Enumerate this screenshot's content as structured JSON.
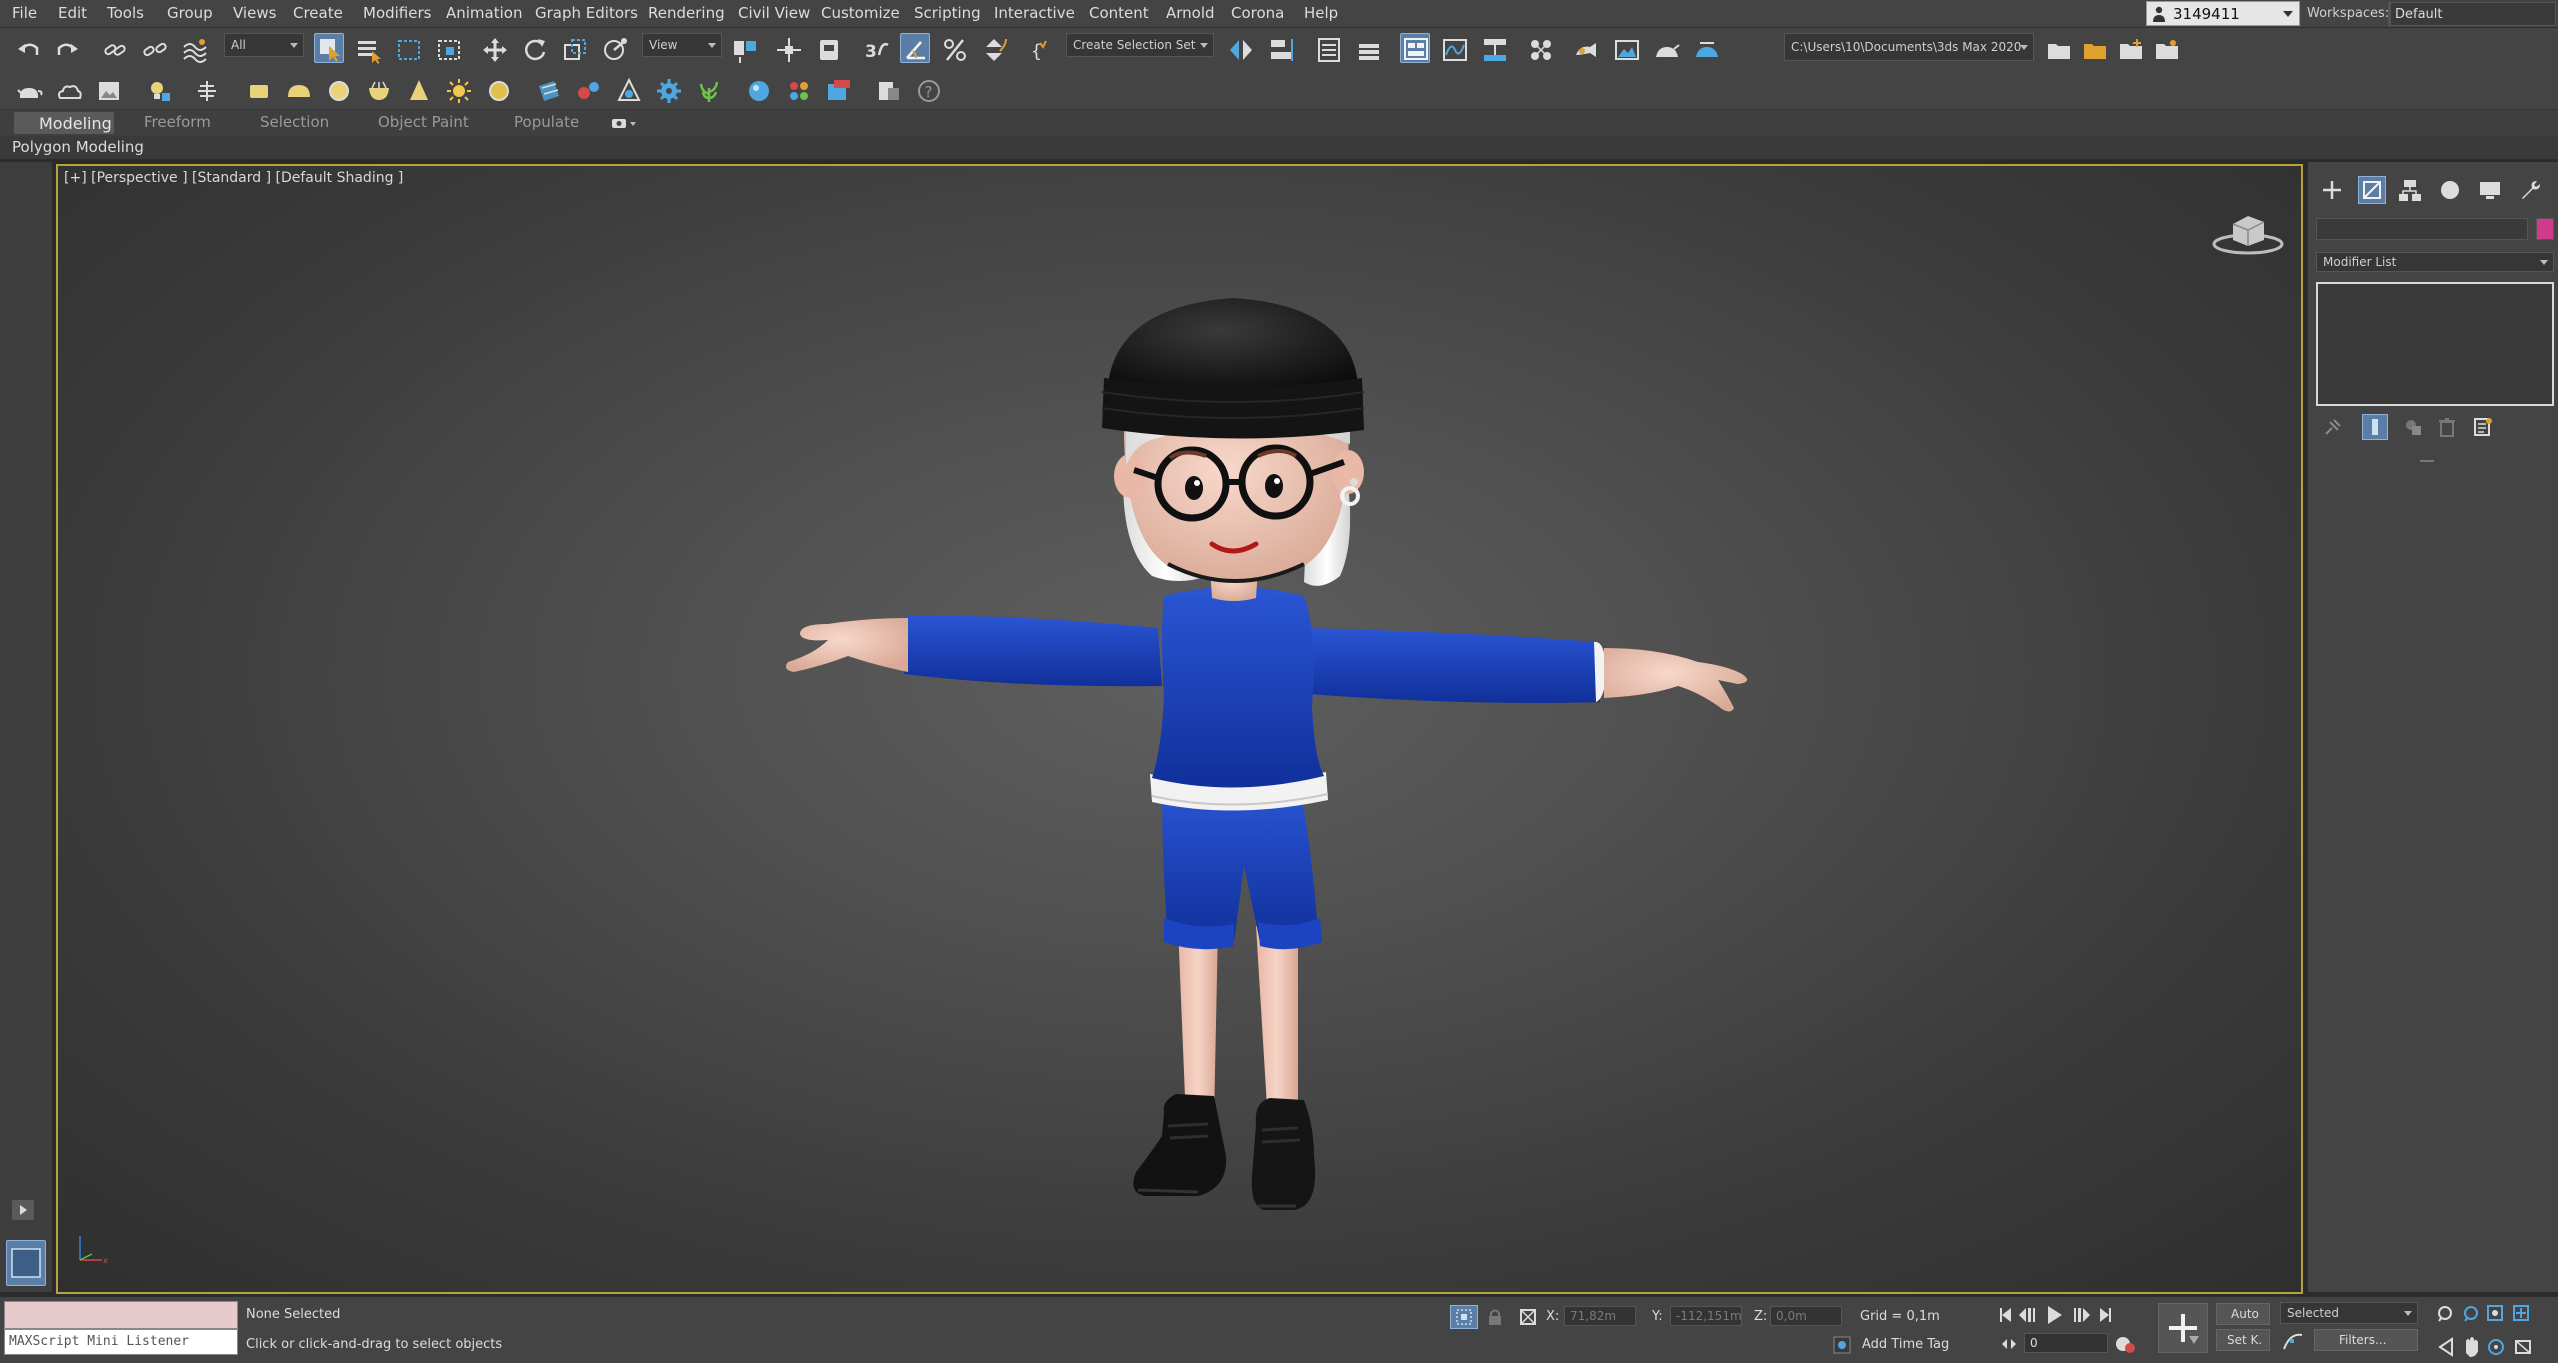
{
  "menu": {
    "items": [
      "File",
      "Edit",
      "Tools",
      "Group",
      "Views",
      "Create",
      "Modifiers",
      "Animation",
      "Graph Editors",
      "Rendering",
      "Civil View",
      "Customize",
      "Scripting",
      "Interactive",
      "Content",
      "Arnold",
      "Corona",
      "Help"
    ]
  },
  "account": {
    "user": "3149411",
    "workspaces_label": "Workspaces:",
    "workspace": "Default"
  },
  "toolbar": {
    "filter": "All",
    "ref_coord": "View",
    "selection_set": "Create Selection Set",
    "project_path": "C:\\Users\\10\\Documents\\3ds Max 2020"
  },
  "ribbon": {
    "tabs": [
      "Modeling",
      "Freeform",
      "Selection",
      "Object Paint",
      "Populate"
    ],
    "panel": "Polygon Modeling"
  },
  "viewport": {
    "label": "[+] [Perspective ] [Standard ] [Default Shading ]",
    "colors": {
      "sweater": "#1a3fb8",
      "skin": "#f2c9b8",
      "hat": "#1a1a1a",
      "hair": "#f0f0f0",
      "shoes": "#151515",
      "border": "#b8a240"
    }
  },
  "command_panel": {
    "modifier_list": "Modifier List",
    "color_swatch": "#d23b8c",
    "tabs": [
      "create-icon",
      "modify-icon",
      "hierarchy-icon",
      "motion-icon",
      "display-icon",
      "utilities-icon"
    ]
  },
  "status": {
    "listener": "MAXScript Mini Listener",
    "selection": "None Selected",
    "prompt": "Click or click-and-drag to select objects",
    "x_label": "X:",
    "x_value": "71,82m",
    "y_label": "Y:",
    "y_value": "-112,151m",
    "z_label": "Z:",
    "z_value": "0,0m",
    "grid": "Grid = 0,1m",
    "add_time_tag": "Add Time Tag",
    "auto": "Auto",
    "set_key": "Set K.",
    "key_filter": "Selected",
    "filters": "Filters...",
    "frame": "0"
  }
}
